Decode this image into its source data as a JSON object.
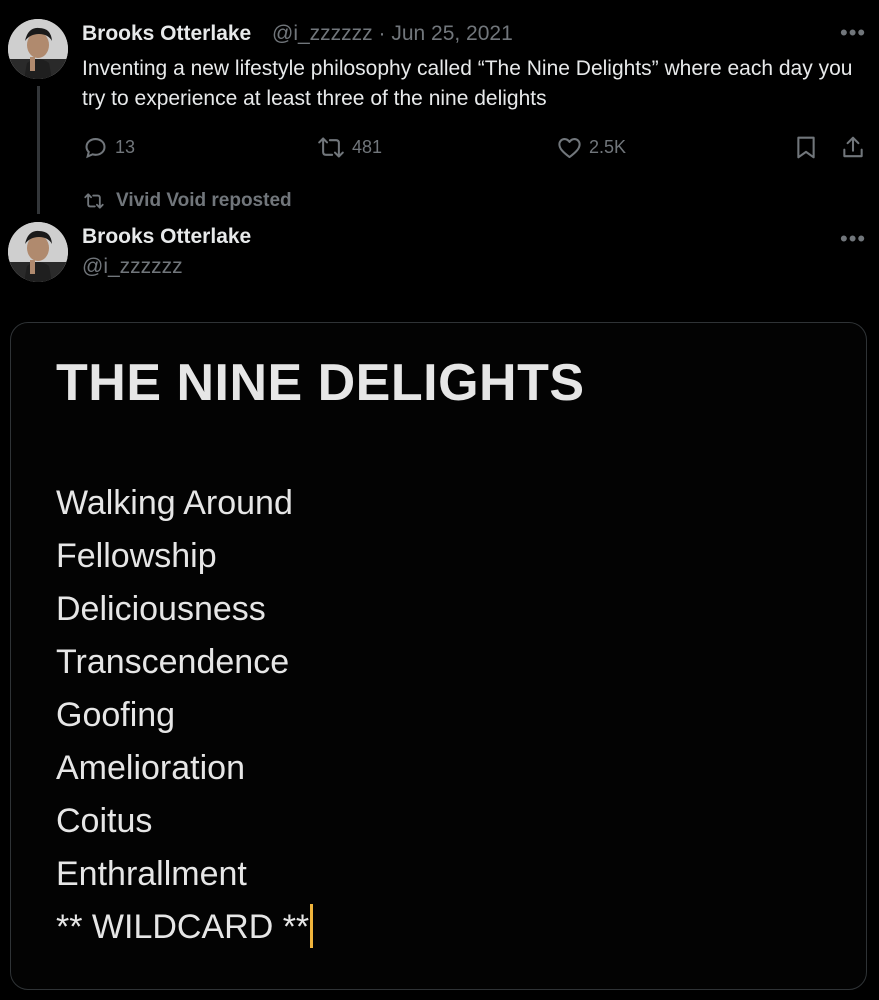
{
  "thread_tweet": {
    "author_name": "Brooks Otterlake",
    "handle_date": "@i_zzzzzz · Jun 25, 2021",
    "text": "Inventing a new lifestyle philosophy called “The Nine Delights” where each day you try to experience at least three of the nine delights",
    "more_icon": "more-dots-icon",
    "actions": {
      "replies": "13",
      "reposts": "481",
      "likes": "2.5K"
    }
  },
  "repost_banner": {
    "icon": "repost-icon",
    "text": "Vivid Void reposted"
  },
  "reply_tweet": {
    "author_name": "Brooks Otterlake",
    "handle": "@i_zzzzzz",
    "more_icon": "more-dots-icon",
    "media": {
      "title": "THE NINE DELIGHTS",
      "items": [
        "Walking Around",
        "Fellowship",
        "Deliciousness",
        "Transcendence",
        "Goofing",
        "Amelioration",
        "Coitus",
        "Enthrallment",
        "** WILDCARD **"
      ],
      "cursor_color": "#f0b43c"
    }
  },
  "colors": {
    "background": "#000000",
    "text_primary": "#e7e9ea",
    "text_secondary": "#71767b",
    "border": "#2f3336"
  }
}
